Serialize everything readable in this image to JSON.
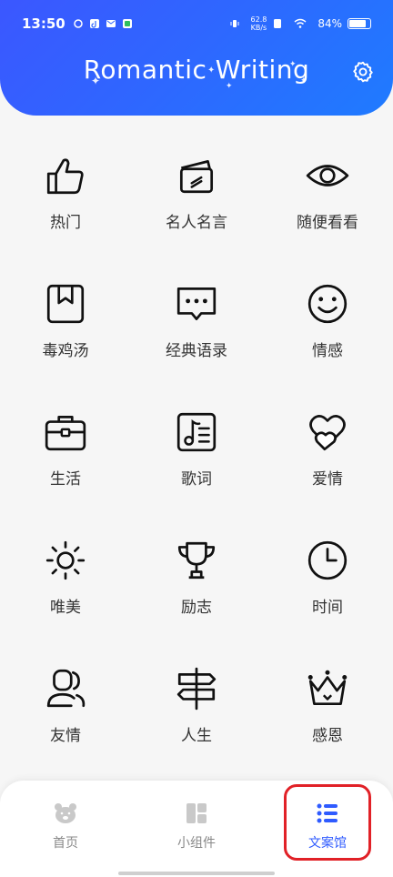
{
  "status_bar": {
    "time": "13:50",
    "net_speed_value": "62.8",
    "net_speed_unit": "KB/s",
    "battery": "84%"
  },
  "header": {
    "title": "Romantic Writing"
  },
  "categories": [
    {
      "label": "热门",
      "icon": "thumbs-up-icon"
    },
    {
      "label": "名人名言",
      "icon": "cards-icon"
    },
    {
      "label": "随便看看",
      "icon": "eye-icon"
    },
    {
      "label": "毒鸡汤",
      "icon": "bookmark-book-icon"
    },
    {
      "label": "经典语录",
      "icon": "chat-bubble-icon"
    },
    {
      "label": "情感",
      "icon": "smile-icon"
    },
    {
      "label": "生活",
      "icon": "briefcase-icon"
    },
    {
      "label": "歌词",
      "icon": "music-note-icon"
    },
    {
      "label": "爱情",
      "icon": "hearts-icon"
    },
    {
      "label": "唯美",
      "icon": "sun-icon"
    },
    {
      "label": "励志",
      "icon": "trophy-icon"
    },
    {
      "label": "时间",
      "icon": "clock-icon"
    },
    {
      "label": "友情",
      "icon": "friends-icon"
    },
    {
      "label": "人生",
      "icon": "signpost-icon"
    },
    {
      "label": "感恩",
      "icon": "crown-icon"
    }
  ],
  "tabs": {
    "home": "首页",
    "widgets": "小组件",
    "copywriting": "文案馆",
    "active": "copywriting"
  },
  "colors": {
    "header_start": "#3b57ff",
    "header_end": "#1f7bff",
    "active_tab": "#2f5bff",
    "inactive_tab": "#888888",
    "highlight_box": "#e12127"
  }
}
